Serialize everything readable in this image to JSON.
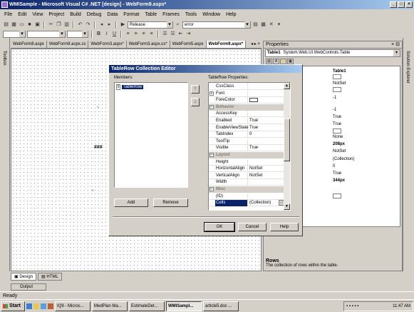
{
  "window": {
    "title": "WMISample - Microsoft Visual C# .NET [design] - WebForm9.aspx*"
  },
  "menu": [
    "File",
    "Edit",
    "View",
    "Project",
    "Build",
    "Debug",
    "Data",
    "Format",
    "Table",
    "Frames",
    "Tools",
    "Window",
    "Help"
  ],
  "toolbar": {
    "config_value": "Release",
    "find_value": "error"
  },
  "tabs": [
    "WebForm8.aspx",
    "WebForm8.aspx.cs",
    "WebForm3.aspx*",
    "WebForm3.aspx.cs*",
    "WebForm5.aspx",
    "WebForm9.aspx*"
  ],
  "designer": {
    "marker": "###",
    "tabs": [
      "Design",
      "HTML"
    ]
  },
  "side_labels": {
    "toolbox": "Toolbox",
    "solution_explorer": "Solution Explorer"
  },
  "output_label": "Output",
  "status_text": "Ready",
  "properties": {
    "title": "Properties",
    "object_name": "Table1",
    "object_type": "System.Web.UI.WebControls.Table",
    "values": [
      "Table1",
      "NotSet",
      "-1",
      "-1",
      "True",
      "True",
      "None",
      "208px",
      "NotSet",
      "(Collection)",
      "0",
      "True",
      "344px"
    ],
    "desc_title": "Rows",
    "desc_text": "The collection of rows within the table."
  },
  "dialog": {
    "title": "TableRow Collection Editor",
    "members_label": "Members:",
    "props_label": "TableRow Properties:",
    "member_index": "0",
    "member_name": "TableRow",
    "up_arrow": "↑",
    "down_arrow": "↓",
    "add_label": "Add",
    "remove_label": "Remove",
    "ok_label": "OK",
    "cancel_label": "Cancel",
    "help_label": "Help",
    "ellipsis": "...",
    "rows": [
      {
        "name": "CssClass",
        "value": ""
      },
      {
        "name": "Font",
        "value": "",
        "expand": "+"
      },
      {
        "name": "ForeColor",
        "value": "",
        "swatch": true
      },
      {
        "name": "Behavior",
        "value": "",
        "cat": true,
        "expand": "−"
      },
      {
        "name": "AccessKey",
        "value": ""
      },
      {
        "name": "Enabled",
        "value": "True"
      },
      {
        "name": "EnableViewState",
        "value": "True"
      },
      {
        "name": "TabIndex",
        "value": "0"
      },
      {
        "name": "ToolTip",
        "value": ""
      },
      {
        "name": "Visible",
        "value": "True"
      },
      {
        "name": "Layout",
        "value": "",
        "cat": true,
        "expand": "−"
      },
      {
        "name": "Height",
        "value": ""
      },
      {
        "name": "HorizontalAlign",
        "value": "NotSet"
      },
      {
        "name": "VerticalAlign",
        "value": "NotSet"
      },
      {
        "name": "Width",
        "value": ""
      },
      {
        "name": "Misc",
        "value": "",
        "cat": true,
        "expand": "−"
      },
      {
        "name": "(ID)",
        "value": ""
      },
      {
        "name": "Cells",
        "value": "(Collection)",
        "sel": true,
        "ellipsis": true
      }
    ]
  },
  "taskbar": {
    "start": "Start",
    "items": [
      "IQ9 - Micros...",
      "MedPlan Ma...",
      "EstimateDet...",
      "WMISampl...",
      "article5.doc ..."
    ],
    "active_index": 3,
    "clock": "11:47 AM"
  }
}
